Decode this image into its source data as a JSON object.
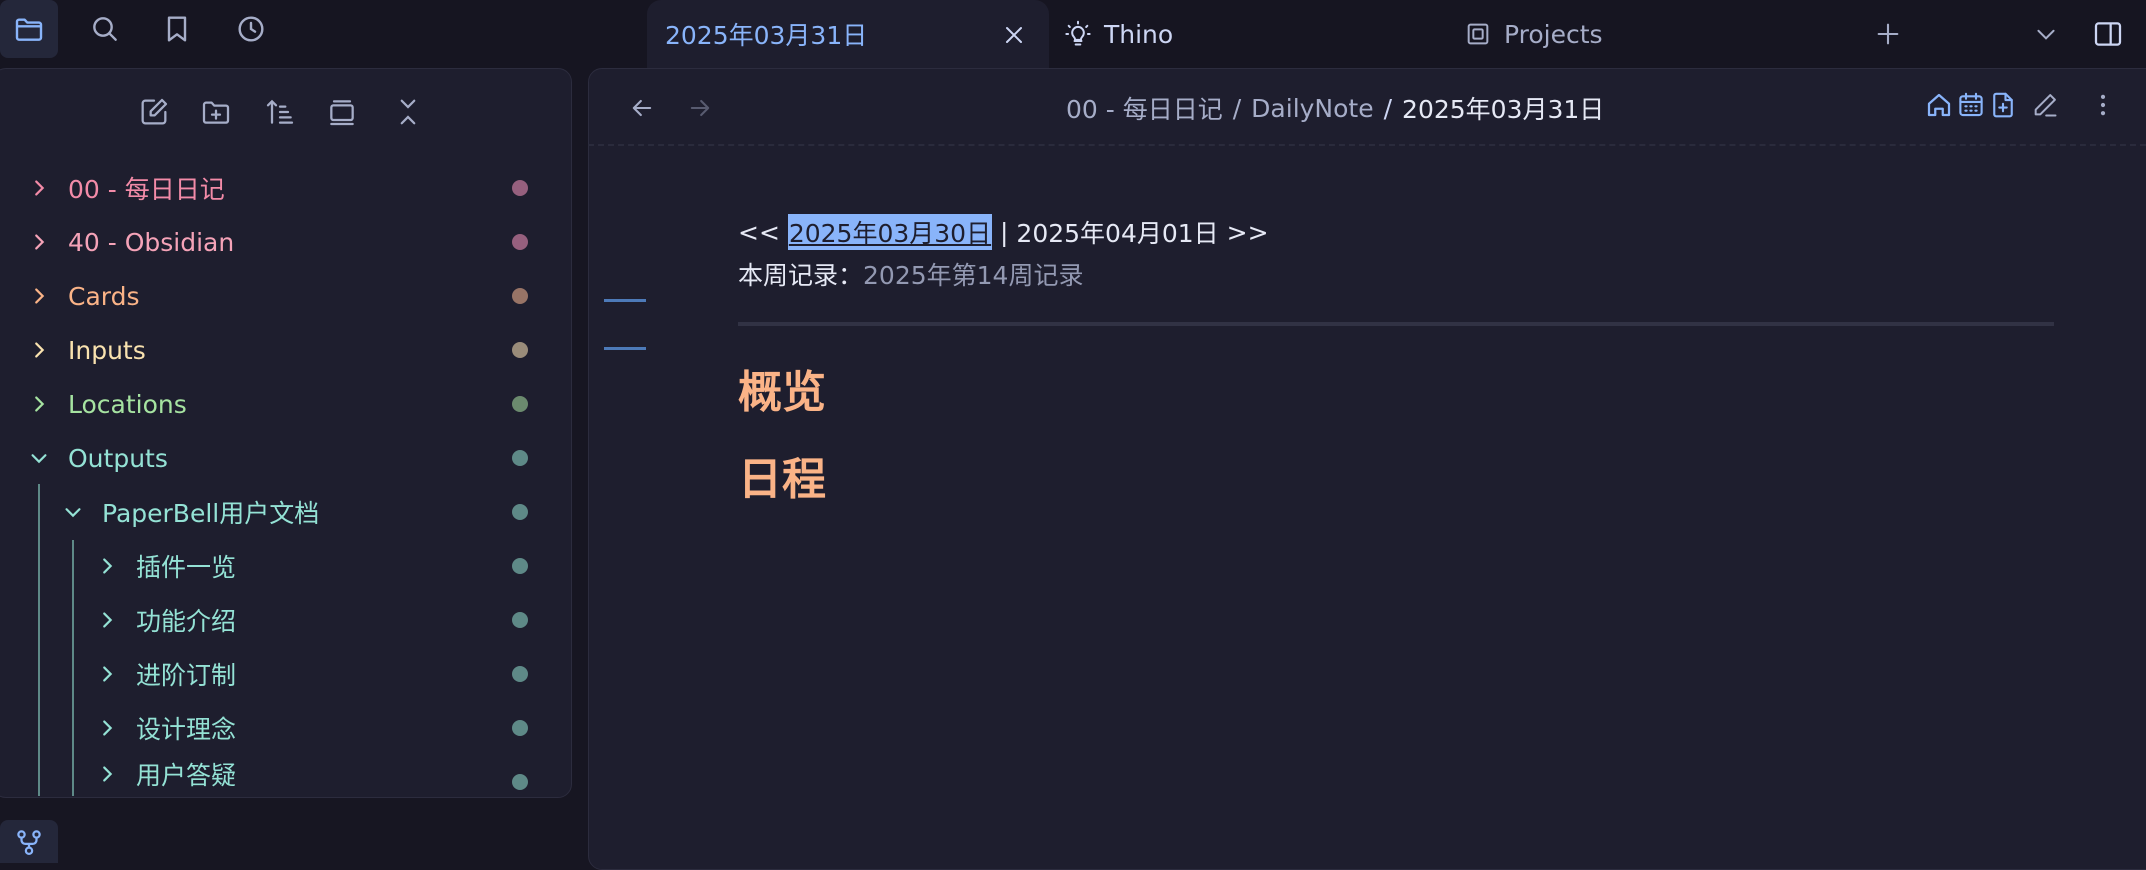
{
  "window": {
    "tabs": [
      {
        "label": "2025年03月31日",
        "active": true
      },
      {
        "label": "Thino",
        "active": false
      },
      {
        "label": "Projects",
        "active": false
      }
    ]
  },
  "ribbon": {
    "icons": [
      "folder-icon",
      "search-icon",
      "bookmark-icon",
      "clock-icon"
    ],
    "bottom_icon": "git-branch-icon"
  },
  "sidebar": {
    "toolbar_icons": [
      "new-note-icon",
      "new-folder-icon",
      "sort-icon",
      "view-icon",
      "collapse-all-icon"
    ],
    "items": [
      {
        "label": "00 - 每日日记",
        "color": "#f38ba8",
        "dot": "#96607e",
        "expanded": false,
        "depth": 0
      },
      {
        "label": "40 - Obsidian",
        "color": "#f5a3b8",
        "dot": "#96607e",
        "expanded": false,
        "depth": 0
      },
      {
        "label": "Cards",
        "color": "#fab387",
        "dot": "#987466",
        "expanded": false,
        "depth": 0
      },
      {
        "label": "Inputs",
        "color": "#f9e2af",
        "dot": "#9a8c7a",
        "expanded": false,
        "depth": 0
      },
      {
        "label": "Locations",
        "color": "#a6e3a1",
        "dot": "#6b8a6e",
        "expanded": false,
        "depth": 0
      },
      {
        "label": "Outputs",
        "color": "#94e2d5",
        "dot": "#5e8987",
        "expanded": true,
        "depth": 0
      },
      {
        "label": "PaperBell用户文档",
        "color": "#94e2d5",
        "dot": "#5e8987",
        "expanded": true,
        "depth": 1
      },
      {
        "label": "插件一览",
        "color": "#94e2d5",
        "dot": "#5e8987",
        "expanded": false,
        "depth": 2
      },
      {
        "label": "功能介绍",
        "color": "#94e2d5",
        "dot": "#5e8987",
        "expanded": false,
        "depth": 2
      },
      {
        "label": "进阶订制",
        "color": "#94e2d5",
        "dot": "#5e8987",
        "expanded": false,
        "depth": 2
      },
      {
        "label": "设计理念",
        "color": "#94e2d5",
        "dot": "#5e8987",
        "expanded": false,
        "depth": 2
      },
      {
        "label": "用户答疑",
        "color": "#94e2d5",
        "dot": "#5e8987",
        "expanded": false,
        "depth": 2
      }
    ]
  },
  "header": {
    "breadcrumb": [
      "00 - 每日日记",
      "DailyNote",
      "2025年03月31日"
    ],
    "separator": "/",
    "action_icons": [
      "home-icon",
      "calendar-icon",
      "new-file-icon",
      "edit-icon",
      "more-icon"
    ]
  },
  "note": {
    "nav_prefix": "<< ",
    "prev_link": "2025年03月30日",
    "nav_sep": " | ",
    "next_link": "2025年04月01日",
    "nav_suffix": " >>",
    "week_label": "本周记录：",
    "week_link": "2025年第14周记录",
    "headings": [
      "概览",
      "日程"
    ]
  },
  "colors": {
    "accent": "#89b4fa",
    "heading": "#fab387",
    "selection": "#89b4fa",
    "background": "#1e1e2e"
  }
}
